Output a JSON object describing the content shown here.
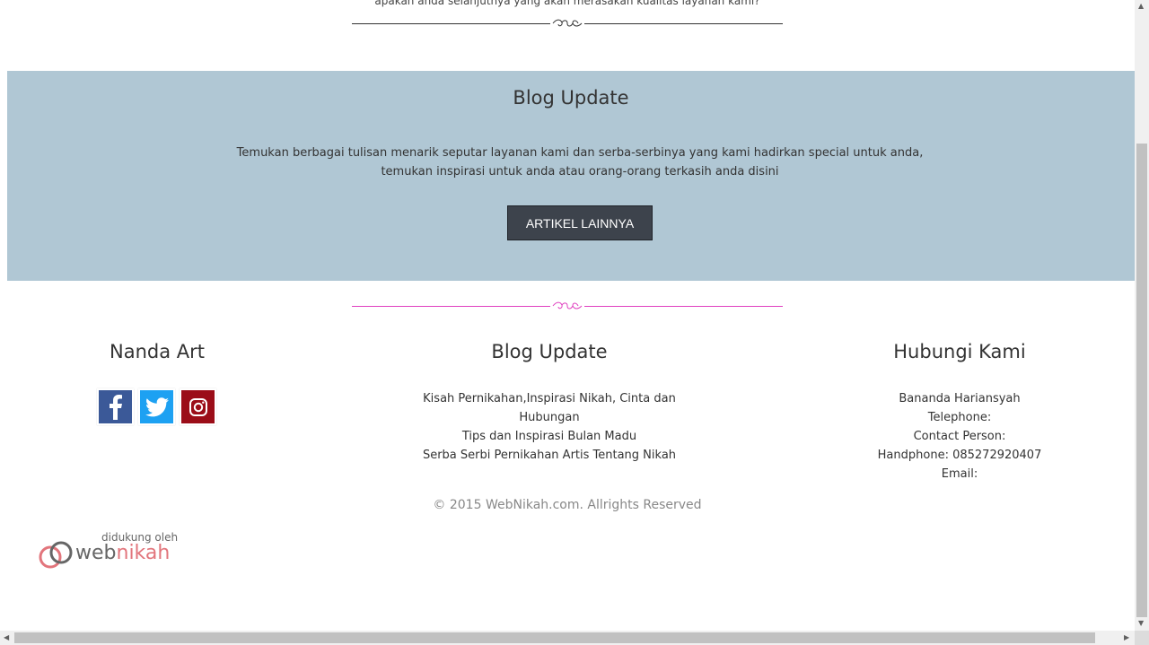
{
  "intro": {
    "text": "apakan anda selanjutnya yang akan merasakan kualitas layanan kami?"
  },
  "blog_band": {
    "title": "Blog Update",
    "line1": "Temukan berbagai tulisan menarik seputar layanan kami dan serba-serbinya yang kami hadirkan special untuk anda,",
    "line2": "temukan inspirasi untuk anda atau orang-orang terkasih anda disini",
    "button_label": "ARTIKEL LAINNYA"
  },
  "footer": {
    "brand": {
      "title": "Nanda Art",
      "social": [
        "facebook-icon",
        "twitter-icon",
        "instagram-icon"
      ]
    },
    "blog": {
      "title": "Blog Update",
      "links": [
        "Kisah Pernikahan,Inspirasi Nikah, Cinta dan Hubungan",
        "Tips dan Inspirasi Bulan Madu",
        "Serba Serbi Pernikahan Artis Tentang Nikah"
      ]
    },
    "contact": {
      "title": "Hubungi Kami",
      "lines": [
        "Bananda Hariansyah",
        "Telephone:",
        "Contact Person:",
        "Handphone: 085272920407",
        "Email:"
      ]
    },
    "copyright": "© 2015 WebNikah.com. Allrights Reserved"
  },
  "support": {
    "label": "didukung oleh",
    "brand_web": "web",
    "brand_nikah": "nikah"
  },
  "colors": {
    "band_bg": "#b0c7d4",
    "button_bg": "#3d434c",
    "ornament_top": "#333333",
    "ornament_pink": "#e040c0"
  }
}
